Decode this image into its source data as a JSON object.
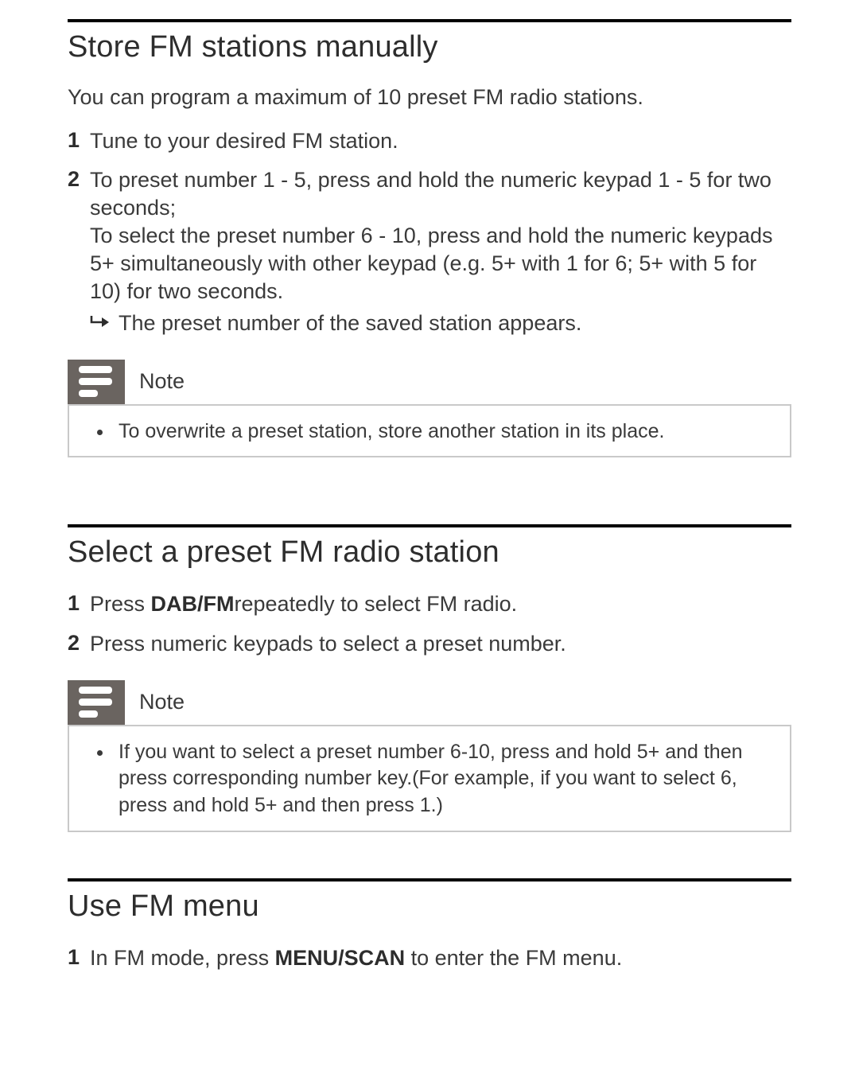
{
  "s1": {
    "title": "Store FM stations manually",
    "intro": "You can program a maximum of 10 preset FM radio stations.",
    "step1": "Tune to your desired FM station.",
    "step2a": "To preset number 1 - 5, press and hold the numeric keypad 1 - 5 for two seconds;",
    "step2b": "To select the preset number 6 - 10, press and hold the numeric keypads 5+ simultaneously with other keypad (e.g. 5+ with 1 for 6; 5+ with 5 for 10) for two seconds.",
    "step2_result": "The preset number of the saved station appears.",
    "note_label": "Note",
    "note_item": "To overwrite a preset station, store another station in its place."
  },
  "s2": {
    "title": "Select a preset FM radio station",
    "step1_pre": "Press ",
    "step1_bold": "DAB/FM",
    "step1_post": "repeatedly to select FM radio.",
    "step2": "Press numeric keypads to select a preset number.",
    "note_label": "Note",
    "note_item": "If you want to select a preset number 6-10, press and hold 5+ and then press corresponding number key.(For example, if you want to select 6, press and hold 5+ and then press 1.)"
  },
  "s3": {
    "title": "Use FM menu",
    "step1_pre": "In FM mode, press ",
    "step1_bold": "MENU/SCAN",
    "step1_post": " to enter the FM menu."
  }
}
